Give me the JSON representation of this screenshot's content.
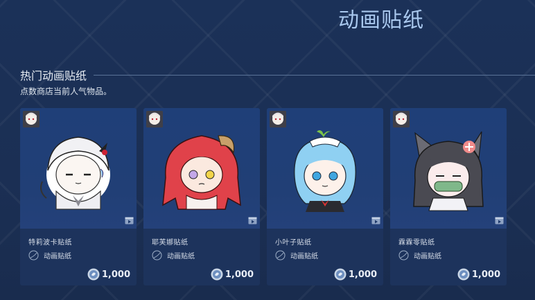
{
  "page": {
    "title": "动画贴纸"
  },
  "section": {
    "title": "热门动画贴纸",
    "subtitle": "点数商店当前人气物品。"
  },
  "colors": {
    "background": "#1c3056",
    "card": "#1d335c",
    "title": "#a9c8ee"
  },
  "cards": [
    {
      "name": "特莉波卡贴纸",
      "type": "动画贴纸",
      "price": "1,000",
      "icons": [
        "avatar-icon",
        "sticker-icon",
        "points-coin-icon",
        "video-icon"
      ]
    },
    {
      "name": "耶芙娜贴纸",
      "type": "动画贴纸",
      "price": "1,000",
      "icons": [
        "avatar-icon",
        "sticker-icon",
        "points-coin-icon",
        "video-icon"
      ]
    },
    {
      "name": "小叶子贴纸",
      "type": "动画贴纸",
      "price": "1,000",
      "icons": [
        "avatar-icon",
        "sticker-icon",
        "points-coin-icon",
        "video-icon"
      ]
    },
    {
      "name": "霖霖零贴纸",
      "type": "动画贴纸",
      "price": "1,000",
      "icons": [
        "avatar-icon",
        "sticker-icon",
        "points-coin-icon",
        "video-icon"
      ]
    }
  ]
}
